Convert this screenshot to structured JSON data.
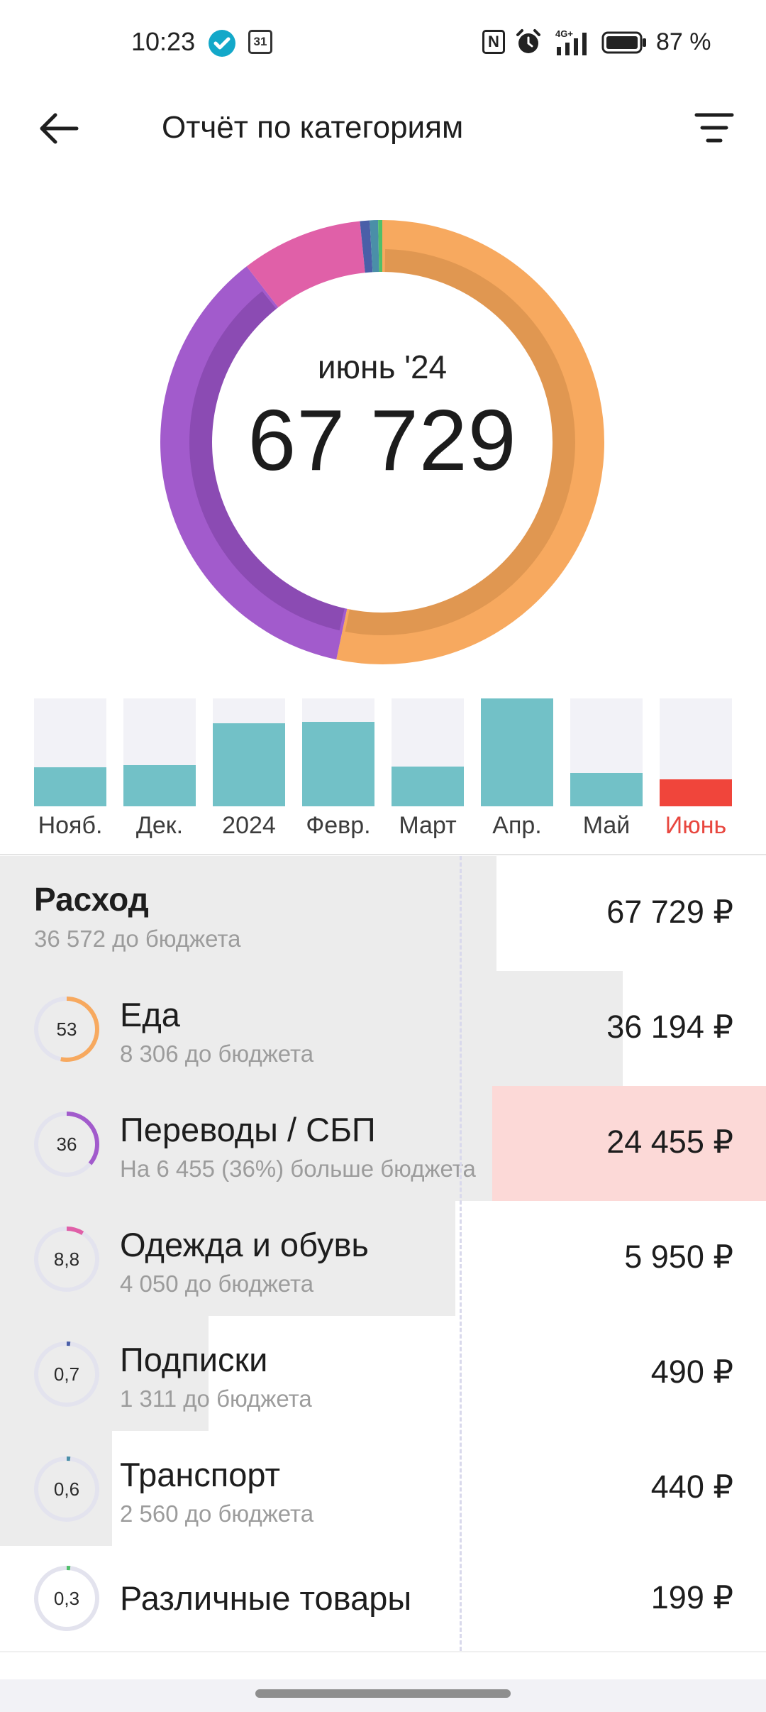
{
  "status_bar": {
    "time": "10:23",
    "calendar_day": "31",
    "nfc": "N",
    "network": "4G+",
    "battery": "87 %"
  },
  "header": {
    "title": "Отчёт по категориям",
    "back_icon": "arrow-left-icon",
    "filter_icon": "filter-icon"
  },
  "donut": {
    "period": "июнь '24",
    "total": "67 729"
  },
  "months": {
    "items": [
      {
        "label": "Нояб.",
        "level": 0.36,
        "active": false
      },
      {
        "label": "Дек.",
        "level": 0.38,
        "active": false
      },
      {
        "label": "2024",
        "level": 0.77,
        "active": false
      },
      {
        "label": "Февр.",
        "level": 0.78,
        "active": false
      },
      {
        "label": "Март",
        "level": 0.37,
        "active": false
      },
      {
        "label": "Апр.",
        "level": 1.0,
        "active": false
      },
      {
        "label": "Май",
        "level": 0.31,
        "active": false
      },
      {
        "label": "Июнь",
        "level": 0.25,
        "active": true
      }
    ],
    "bar_color": "#72c1c7",
    "active_color": "#f0453b",
    "active_label_color": "#e8473f"
  },
  "summary": {
    "title": "Расход",
    "subtitle": "36 572 до бюджета",
    "amount": "67 729 ₽"
  },
  "categories": [
    {
      "name": "Еда",
      "percent": "53",
      "subtitle": "8 306 до бюджета",
      "amount": "36 194 ₽",
      "color": "#f7a95f",
      "over_budget": false
    },
    {
      "name": "Переводы / СБП",
      "percent": "36",
      "subtitle": "На 6 455 (36%) больше бюджета",
      "amount": "24 455 ₽",
      "color": "#a25bcc",
      "over_budget": true
    },
    {
      "name": "Одежда и обувь",
      "percent": "8,8",
      "subtitle": "4 050 до бюджета",
      "amount": "5 950 ₽",
      "color": "#e060a8",
      "over_budget": false
    },
    {
      "name": "Подписки",
      "percent": "0,7",
      "subtitle": "1 311 до бюджета",
      "amount": "490 ₽",
      "color": "#4a5fa8",
      "over_budget": false
    },
    {
      "name": "Транспорт",
      "percent": "0,6",
      "subtitle": "2 560 до бюджета",
      "amount": "440 ₽",
      "color": "#4a8fa8",
      "over_budget": false
    },
    {
      "name": "Различные товары",
      "percent": "0,3",
      "subtitle": "",
      "amount": "199 ₽",
      "color": "#4fbf6a",
      "over_budget": false
    }
  ]
}
